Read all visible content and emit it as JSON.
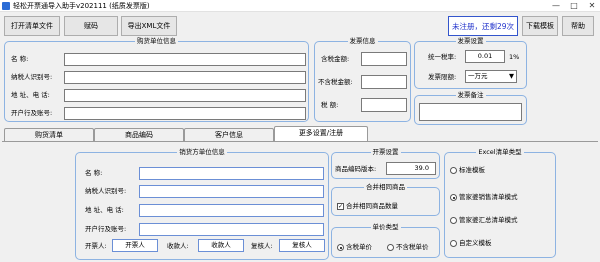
{
  "window": {
    "title": "轻松开票通导入助手v202111 (纸质发票版)",
    "minimize": "—",
    "maximize": "□",
    "close": "✕"
  },
  "toolbar": {
    "open_list": "打开清单文件",
    "code": "赋码",
    "export_xml": "导出XML文件",
    "register": "未注册，还剩29次",
    "download_template": "下载模板",
    "help": "帮助"
  },
  "buyer": {
    "title": "购货单位信息",
    "name_label": "名      称:",
    "tax_id_label": "纳税人识别号:",
    "addr_label": "地  址、电  话:",
    "bank_label": "开户行及账号:",
    "name_value": "",
    "tax_id_value": "",
    "addr_value": "",
    "bank_value": ""
  },
  "invoice_info": {
    "title": "发票信息",
    "tax_incl_label": "含税金额:",
    "tax_excl_label": "不含税金额:",
    "tax_label": "税      额:"
  },
  "invoice_settings": {
    "title": "发票设置",
    "rate_label": "统一税率:",
    "rate_value": "0.01",
    "rate_unit": "1%",
    "limit_label": "发票限额:",
    "limit_value": "一万元"
  },
  "invoice_remark": {
    "title": "发票备注"
  },
  "tabs": [
    "购货清单",
    "商品编码",
    "客户信息",
    "更多设置/注册"
  ],
  "seller": {
    "title": "销货方单位信息",
    "name_label": "名      称:",
    "tax_id_label": "纳税人识别号:",
    "addr_label": "地  址、电  话:",
    "bank_label": "开户行及账号:",
    "issuer_label": "开票人:",
    "issuer_value": "开票人",
    "payee_label": "收款人:",
    "payee_value": "收款人",
    "reviewer_label": "复核人:",
    "reviewer_value": "复核人"
  },
  "open_settings": {
    "title": "开票设置",
    "code_version_label": "商品编码版本:",
    "code_version_value": "39.0"
  },
  "merge": {
    "title": "合并相同商品",
    "checkbox_label": "合并相同商品数量"
  },
  "unit_price": {
    "title": "单价类型",
    "tax_incl": "含税单价",
    "tax_excl": "不含税单价"
  },
  "excel_type": {
    "title": "Excel清单类型",
    "options": [
      "标准模板",
      "管家婆销售清单模式",
      "管家婆汇总清单模式",
      "自定义模板"
    ],
    "selected": 1
  }
}
